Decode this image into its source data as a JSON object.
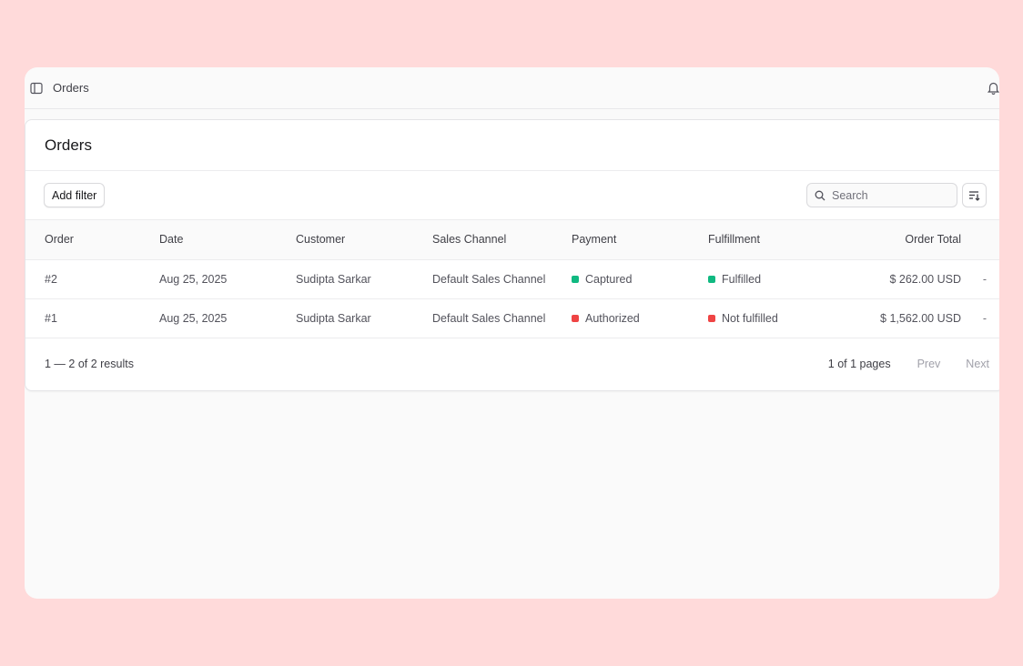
{
  "topbar": {
    "breadcrumb": "Orders"
  },
  "card": {
    "title": "Orders"
  },
  "toolbar": {
    "add_filter_label": "Add filter",
    "search_placeholder": "Search"
  },
  "table": {
    "columns": [
      "Order",
      "Date",
      "Customer",
      "Sales Channel",
      "Payment",
      "Fulfillment",
      "Order Total"
    ],
    "rows": [
      {
        "order": "#2",
        "date": "Aug 25, 2025",
        "customer": "Sudipta Sarkar",
        "channel": "Default Sales Channel",
        "payment": "Captured",
        "payment_color": "#10b981",
        "fulfillment": "Fulfilled",
        "fulfillment_color": "#10b981",
        "total": "$ 262.00 USD",
        "action": "-"
      },
      {
        "order": "#1",
        "date": "Aug 25, 2025",
        "customer": "Sudipta Sarkar",
        "channel": "Default Sales Channel",
        "payment": "Authorized",
        "payment_color": "#ef4444",
        "fulfillment": "Not fulfilled",
        "fulfillment_color": "#ef4444",
        "total": "$ 1,562.00 USD",
        "action": "-"
      }
    ]
  },
  "footer": {
    "results": "1 — 2 of 2 results",
    "pages": "1 of 1 pages",
    "prev_label": "Prev",
    "next_label": "Next"
  },
  "icons": {
    "sidebar_toggle": "sidebar-toggle-icon",
    "bell": "bell-icon",
    "search": "search-icon",
    "sort": "sort-icon"
  }
}
